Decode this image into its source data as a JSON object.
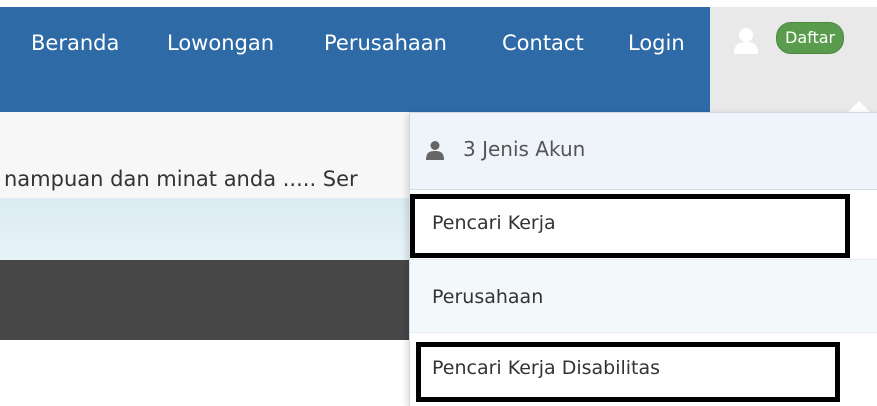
{
  "nav": {
    "items": [
      "Beranda",
      "Lowongan",
      "Perusahaan",
      "Contact",
      "Login"
    ]
  },
  "user_menu": {
    "badge_label": "Daftar",
    "user_icon": "user-icon"
  },
  "marquee": {
    "text": "nampuan dan minat anda ..... Ser"
  },
  "dropdown": {
    "header_icon": "user-icon",
    "header_text": "3 Jenis Akun",
    "items": [
      "Pencari Kerja",
      "Perusahaan",
      "Pencari Kerja Disabilitas"
    ]
  },
  "colors": {
    "navbar": "#2d6aa6",
    "badge": "#5a9c4e",
    "dark_band": "#474747"
  }
}
